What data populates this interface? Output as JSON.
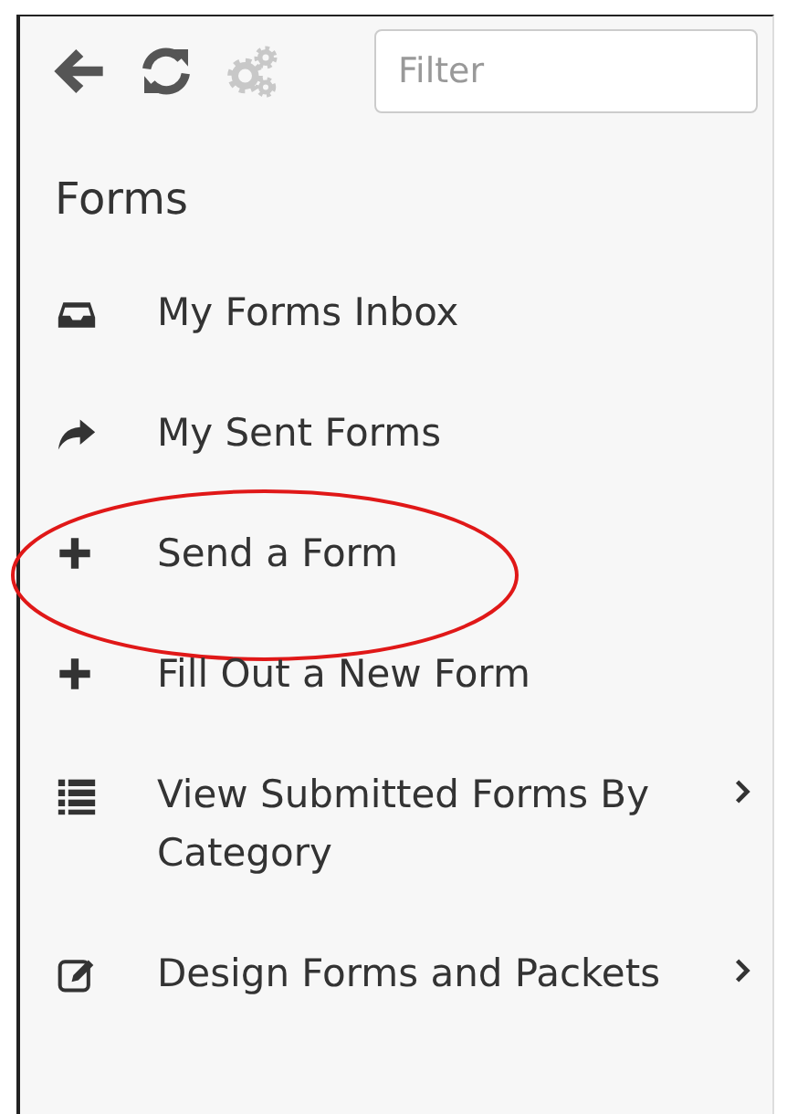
{
  "toolbar": {
    "buttons": [
      {
        "kind": "back",
        "disabled": false
      },
      {
        "kind": "refresh",
        "disabled": false
      },
      {
        "kind": "settings",
        "disabled": true
      }
    ],
    "filter": {
      "placeholder": "Filter"
    }
  },
  "heading": "Forms",
  "menu": [
    {
      "kind": "inbox",
      "label": "My Forms Inbox",
      "submenu": false,
      "highlighted": false
    },
    {
      "kind": "share",
      "label": "My Sent Forms",
      "submenu": false,
      "highlighted": false
    },
    {
      "kind": "plus",
      "label": "Send a Form",
      "submenu": false,
      "highlighted": true
    },
    {
      "kind": "plus",
      "label": "Fill Out a New Form",
      "submenu": false,
      "highlighted": false
    },
    {
      "kind": "list",
      "label": "View Submitted Forms By Category",
      "submenu": true,
      "highlighted": false
    },
    {
      "kind": "edit",
      "label": "Design Forms and Packets",
      "submenu": true,
      "highlighted": false
    }
  ]
}
